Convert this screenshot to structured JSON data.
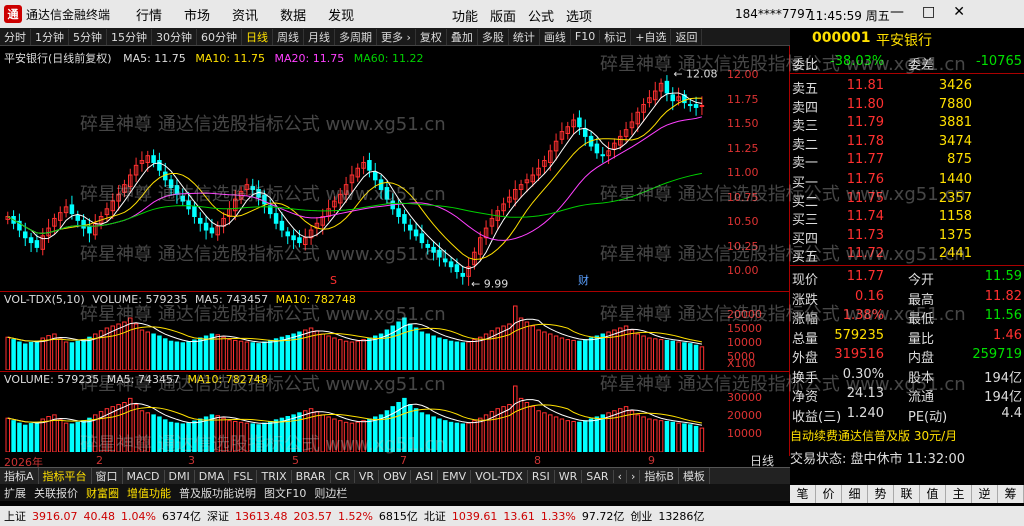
{
  "title": {
    "app": "通达信金融终端",
    "menus": [
      "行情",
      "市场",
      "资讯",
      "数据",
      "发现"
    ],
    "menus2": [
      "功能",
      "版面",
      "公式",
      "选项"
    ],
    "account": "184****7797",
    "time": "11:45:59 周五"
  },
  "toolbar": [
    {
      "label": "分时",
      "on": false
    },
    {
      "label": "1分钟",
      "on": false
    },
    {
      "label": "5分钟",
      "on": false
    },
    {
      "label": "15分钟",
      "on": false
    },
    {
      "label": "30分钟",
      "on": false
    },
    {
      "label": "60分钟",
      "on": false
    },
    {
      "label": "日线",
      "on": true
    },
    {
      "label": "周线",
      "on": false
    },
    {
      "label": "月线",
      "on": false
    },
    {
      "label": "多周期",
      "on": false
    },
    {
      "label": "更多 ›",
      "on": false
    },
    {
      "label": "复权",
      "on": false
    },
    {
      "label": "叠加",
      "on": false
    },
    {
      "label": "多股",
      "on": false
    },
    {
      "label": "统计",
      "on": false
    },
    {
      "label": "画线",
      "on": false
    },
    {
      "label": "F10",
      "on": false
    },
    {
      "label": "标记",
      "on": false
    },
    {
      "label": "+自选",
      "on": false
    },
    {
      "label": "返回",
      "on": false
    }
  ],
  "main_legend": {
    "name": "平安银行(日线前复权)",
    "ma5": "MA5: 11.75",
    "ma10": "MA10: 11.75",
    "ma20": "MA20: 11.75",
    "ma60": "MA60: 11.22"
  },
  "price_axis": [
    "12.00",
    "11.75",
    "11.50",
    "11.25",
    "11.00",
    "10.75",
    "10.50",
    "10.25",
    "10.00"
  ],
  "high_label": "12.08",
  "low_label": "9.99",
  "marker_s": "S",
  "marker_cai": "财",
  "vol1_legend": {
    "name": "VOL-TDX(5,10)",
    "volume": "VOLUME: 579235",
    "ma5": "MA5: 743457",
    "ma10": "MA10: 782748"
  },
  "vol_axis": [
    "20000",
    "15000",
    "10000",
    "5000"
  ],
  "vol_unit": "X100",
  "vol2_legend": {
    "name": "VOLUME: 579235",
    "ma5": "MA5: 743457",
    "ma10": "MA10: 782748"
  },
  "vol2_axis": [
    "30000",
    "20000",
    "10000"
  ],
  "dates": [
    "2026年",
    "2",
    "3",
    "4",
    "5",
    "6",
    "7",
    "8",
    "9"
  ],
  "period_label": "日线",
  "indicator_tabs": [
    "指标A",
    "指标平台",
    "窗口",
    "MACD",
    "DMI",
    "DMA",
    "FSL",
    "TRIX",
    "BRAR",
    "CR",
    "VR",
    "OBV",
    "ASI",
    "EMV",
    "VOL-TDX",
    "RSI",
    "WR",
    "SAR",
    "‹",
    "›",
    "指标B",
    "模板"
  ],
  "bottom_tabs": [
    "扩展",
    "关联报价",
    "财富圈",
    "增值功能",
    "普及版功能说明",
    "图文F10",
    "则边栏"
  ],
  "stock": {
    "code": "000001",
    "name": "平安银行",
    "wb_label": "委比",
    "wb": "-38.03%",
    "wc_label": "委差",
    "wc": "-10765"
  },
  "sells": [
    {
      "label": "卖五",
      "price": "11.81",
      "vol": "3426"
    },
    {
      "label": "卖四",
      "price": "11.80",
      "vol": "7880"
    },
    {
      "label": "卖三",
      "price": "11.79",
      "vol": "3881"
    },
    {
      "label": "卖二",
      "price": "11.78",
      "vol": "3474"
    },
    {
      "label": "卖一",
      "price": "11.77",
      "vol": "875"
    }
  ],
  "buys": [
    {
      "label": "买一",
      "price": "11.76",
      "vol": "1440"
    },
    {
      "label": "买二",
      "price": "11.75",
      "vol": "2357"
    },
    {
      "label": "买三",
      "price": "11.74",
      "vol": "1158"
    },
    {
      "label": "买四",
      "price": "11.73",
      "vol": "1375"
    },
    {
      "label": "买五",
      "price": "11.72",
      "vol": "2441"
    }
  ],
  "quote": [
    {
      "l1": "现价",
      "v1": "11.77",
      "c1": "red",
      "l2": "今开",
      "v2": "11.59",
      "c2": "grn"
    },
    {
      "l1": "涨跌",
      "v1": "0.16",
      "c1": "red",
      "l2": "最高",
      "v2": "11.82",
      "c2": "red"
    },
    {
      "l1": "涨幅",
      "v1": "1.38%",
      "c1": "red",
      "l2": "最低",
      "v2": "11.56",
      "c2": "grn"
    },
    {
      "l1": "总量",
      "v1": "579235",
      "c1": "yel",
      "l2": "量比",
      "v2": "1.46",
      "c2": "red"
    },
    {
      "l1": "外盘",
      "v1": "319516",
      "c1": "red",
      "l2": "内盘",
      "v2": "259719",
      "c2": "grn"
    },
    {
      "l1": "换手",
      "v1": "0.30%",
      "c1": "wht",
      "l2": "股本",
      "v2": "194亿",
      "c2": "wht"
    },
    {
      "l1": "净资",
      "v1": "24.13",
      "c1": "wht",
      "l2": "流通",
      "v2": "194亿",
      "c2": "wht"
    },
    {
      "l1": "收益(三)",
      "v1": "1.240",
      "c1": "wht",
      "l2": "PE(动)",
      "v2": "4.4",
      "c2": "wht"
    }
  ],
  "promo": "自动续费通达信普及版 30元/月",
  "trade_state": "交易状态: 盘中休市 11:32:00",
  "side_tabs": [
    "笔",
    "价",
    "细",
    "势",
    "联",
    "值",
    "主",
    "逆",
    "筹"
  ],
  "status": [
    {
      "t": "上证",
      "c": ""
    },
    {
      "t": "3916.07",
      "c": "r"
    },
    {
      "t": "40.48",
      "c": "r"
    },
    {
      "t": "1.04%",
      "c": "r"
    },
    {
      "t": "6374亿",
      "c": ""
    },
    {
      "t": "深证",
      "c": ""
    },
    {
      "t": "13613.48",
      "c": "r"
    },
    {
      "t": "203.57",
      "c": "r"
    },
    {
      "t": "1.52%",
      "c": "r"
    },
    {
      "t": "6815亿",
      "c": ""
    },
    {
      "t": "北证",
      "c": ""
    },
    {
      "t": "1039.61",
      "c": "r"
    },
    {
      "t": "13.61",
      "c": "r"
    },
    {
      "t": "1.33%",
      "c": "r"
    },
    {
      "t": "97.72亿",
      "c": ""
    },
    {
      "t": "创业",
      "c": ""
    },
    {
      "t": "13286亿",
      "c": ""
    }
  ],
  "watermark": "碎星神尊 通达信选股指标公式 www.xg51.cn",
  "colors": {
    "up": "#ff3030",
    "down": "#00ffff",
    "ma5": "#ffffff",
    "ma10": "#ffe000",
    "ma20": "#ff40ff",
    "ma60": "#00d000"
  },
  "chart_data": {
    "type": "candlestick",
    "ylim": [
      9.9,
      12.2
    ],
    "high": 12.08,
    "low": 9.99,
    "closes": [
      10.62,
      10.55,
      10.48,
      10.4,
      10.35,
      10.3,
      10.42,
      10.5,
      10.6,
      10.66,
      10.72,
      10.65,
      10.58,
      10.5,
      10.45,
      10.55,
      10.62,
      10.7,
      10.78,
      10.85,
      10.95,
      11.05,
      11.15,
      11.2,
      11.25,
      11.18,
      11.1,
      11.0,
      10.92,
      10.85,
      10.78,
      10.7,
      10.62,
      10.55,
      10.48,
      10.45,
      10.52,
      10.6,
      10.7,
      10.8,
      10.88,
      10.95,
      10.9,
      10.82,
      10.75,
      10.65,
      10.55,
      10.48,
      10.42,
      10.38,
      10.35,
      10.4,
      10.48,
      10.55,
      10.62,
      10.7,
      10.78,
      10.85,
      10.95,
      11.05,
      11.12,
      11.18,
      11.1,
      11.0,
      10.9,
      10.8,
      10.7,
      10.62,
      10.55,
      10.48,
      10.42,
      10.35,
      10.3,
      10.25,
      10.2,
      10.15,
      10.1,
      10.05,
      10.0,
      10.1,
      10.25,
      10.4,
      10.5,
      10.6,
      10.68,
      10.75,
      10.82,
      10.9,
      10.95,
      11.0,
      11.05,
      11.12,
      11.2,
      11.3,
      11.4,
      11.5,
      11.55,
      11.62,
      11.55,
      11.45,
      11.35,
      11.28,
      11.25,
      11.3,
      11.38,
      11.45,
      11.52,
      11.6,
      11.7,
      11.78,
      11.85,
      11.92,
      12.0,
      11.9,
      11.82,
      11.86,
      11.8,
      11.78,
      11.75,
      11.77
    ],
    "volumes": [
      820000,
      760000,
      700000,
      650000,
      690000,
      720000,
      800000,
      860000,
      900000,
      780000,
      700000,
      680000,
      720000,
      760000,
      820000,
      900000,
      980000,
      1050000,
      1100000,
      1150000,
      1200000,
      1300000,
      1150000,
      1000000,
      950000,
      900000,
      850000,
      780000,
      720000,
      700000,
      680000,
      700000,
      750000,
      800000,
      850000,
      900000,
      880000,
      820000,
      760000,
      740000,
      720000,
      700000,
      680000,
      660000,
      700000,
      740000,
      780000,
      820000,
      860000,
      900000,
      950000,
      1000000,
      1050000,
      980000,
      900000,
      850000,
      800000,
      760000,
      720000,
      700000,
      720000,
      760000,
      800000,
      850000,
      900000,
      1000000,
      1100000,
      1200000,
      1300000,
      1150000,
      1050000,
      950000,
      900000,
      850000,
      800000,
      760000,
      720000,
      700000,
      680000,
      700000,
      760000,
      820000,
      900000,
      980000,
      1050000,
      1100000,
      1150000,
      1600000,
      1300000,
      1200000,
      1100000,
      1000000,
      950000,
      900000,
      850000,
      800000,
      760000,
      740000,
      720000,
      760000,
      800000,
      850000,
      900000,
      950000,
      1000000,
      1050000,
      1100000,
      1000000,
      900000,
      850000,
      800000,
      780000,
      760000,
      740000,
      720000,
      700000,
      680000,
      660000,
      620000,
      579235
    ]
  }
}
